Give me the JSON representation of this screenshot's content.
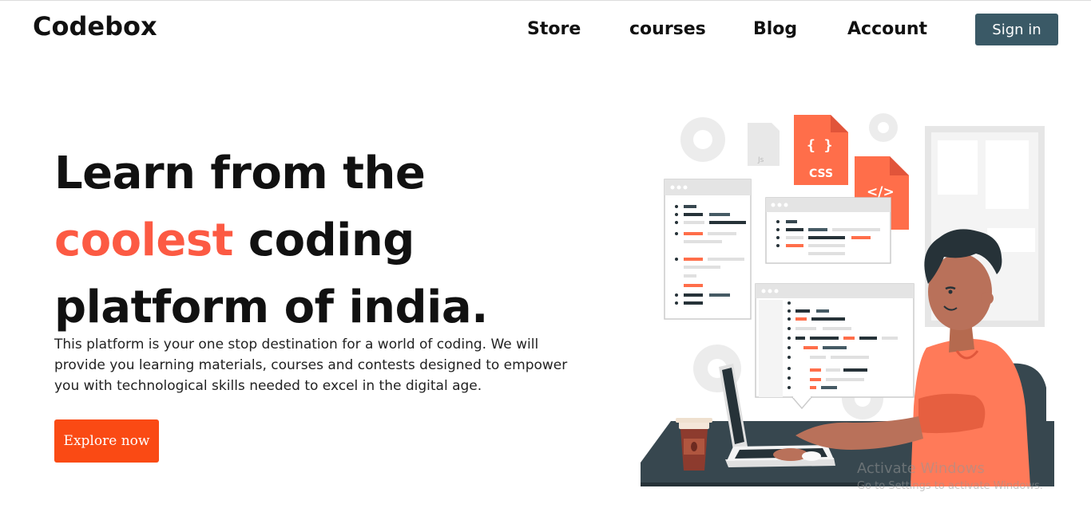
{
  "header": {
    "logo": "Codebox",
    "nav": [
      "Store",
      "courses",
      "Blog",
      "Account"
    ],
    "signin_label": "Sign in"
  },
  "hero": {
    "title_part1": "Learn from the ",
    "title_accent": "coolest",
    "title_part2": " coding platform of india.",
    "description": "This platform is your one stop destination for a world of coding. We will provide you learning materials, courses and contests designed to empower you with technological skills needed to excel in the digital age.",
    "cta_label": "Explore now"
  },
  "illustration": {
    "css_label": "CSS",
    "html_label": "</>",
    "js_label": "Js",
    "braces_label": "{ }"
  },
  "watermark": {
    "title": "Activate Windows",
    "subtitle": "Go to Settings to activate Windows."
  },
  "colors": {
    "accent": "#fc5a43",
    "cta": "#fa4a14",
    "signin": "#3a5966",
    "shirt": "#ff7a59",
    "dark": "#263238"
  }
}
